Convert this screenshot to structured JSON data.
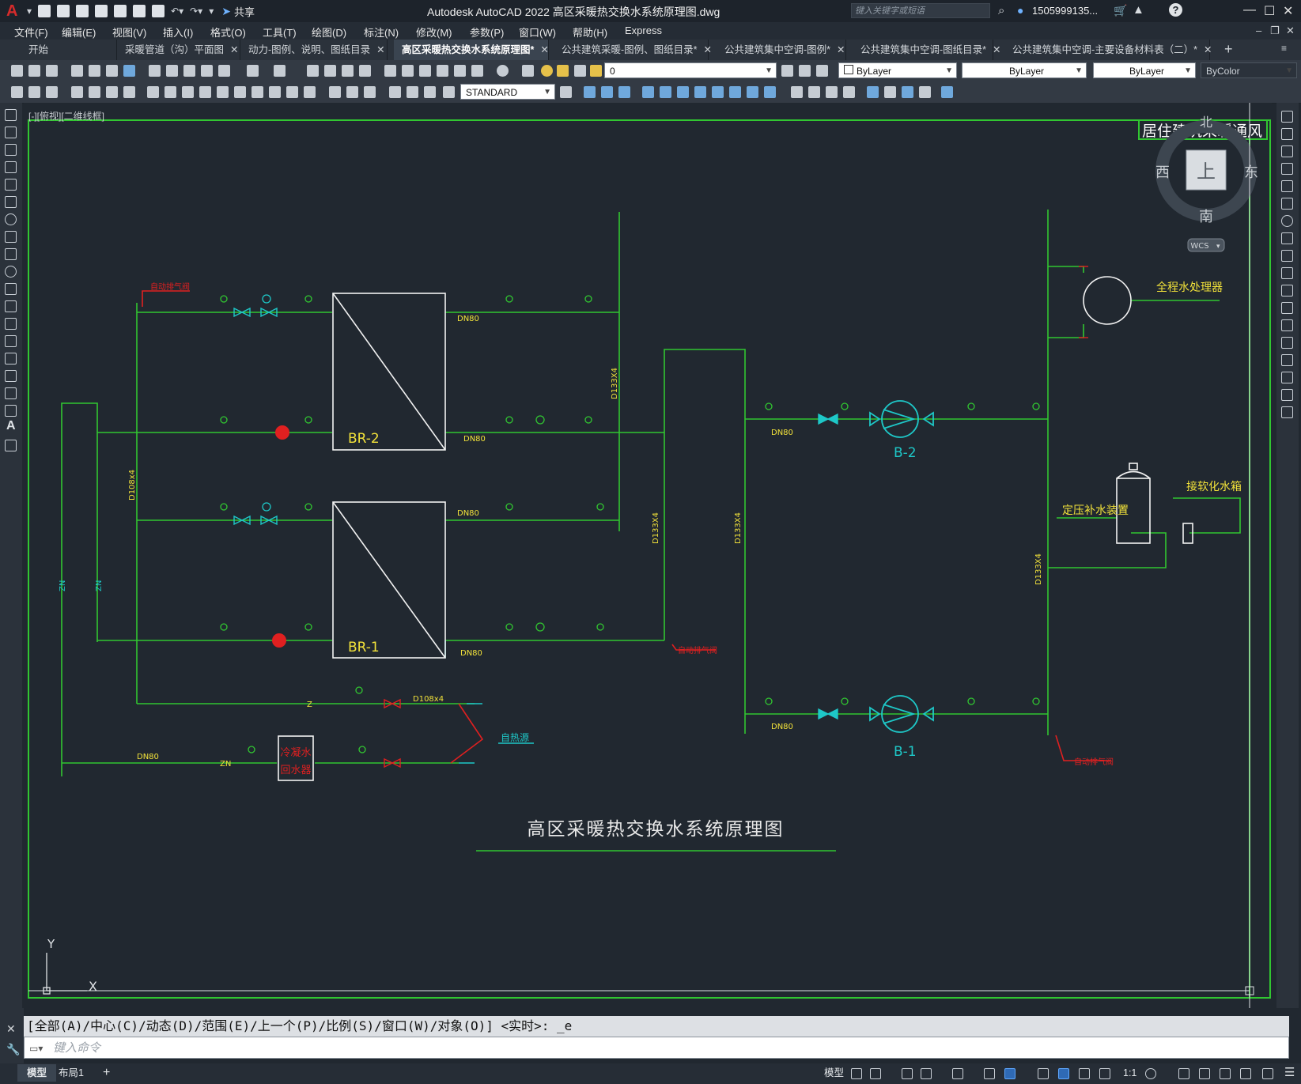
{
  "app": {
    "logo": "A",
    "title": "Autodesk AutoCAD 2022    高区采暖热交换水系统原理图.dwg",
    "share_label": "共享",
    "search_placeholder": "键入关键字或短语",
    "user": "1505999135...",
    "help": "?"
  },
  "menu": [
    "文件(F)",
    "编辑(E)",
    "视图(V)",
    "插入(I)",
    "格式(O)",
    "工具(T)",
    "绘图(D)",
    "标注(N)",
    "修改(M)",
    "参数(P)",
    "窗口(W)",
    "帮助(H)",
    "Express"
  ],
  "tabs": [
    {
      "label": "开始",
      "active": false,
      "closable": false
    },
    {
      "label": "采暖管道（沟）平面图",
      "active": false,
      "closable": true
    },
    {
      "label": "动力-图例、说明、图纸目录",
      "active": false,
      "closable": true
    },
    {
      "label": "高区采暖热交换水系统原理图*",
      "active": true,
      "closable": true
    },
    {
      "label": "公共建筑采暖-图例、图纸目录*",
      "active": false,
      "closable": true
    },
    {
      "label": "公共建筑集中空调-图例*",
      "active": false,
      "closable": true
    },
    {
      "label": "公共建筑集中空调-图纸目录*",
      "active": false,
      "closable": true
    },
    {
      "label": "公共建筑集中空调-主要设备材料表（二）*",
      "active": false,
      "closable": true
    }
  ],
  "toolbar": {
    "layer_value": "0",
    "color_value": "ByLayer",
    "linetype_value": "ByLayer",
    "lineweight_value": "ByLayer",
    "plotstyle_value": "ByColor",
    "textstyle_value": "STANDARD"
  },
  "viewport_label": "[-][俯视][二维线框]",
  "viewcube": {
    "top_face": "上",
    "north": "北",
    "south": "南",
    "east": "东",
    "west": "西",
    "ucs": "WCS"
  },
  "ucs_icon": {
    "x": "X",
    "y": "Y"
  },
  "drawing": {
    "title": "高区采暖热交换水系统原理图",
    "frame_label": "居住建筑采暖通风",
    "equipment": {
      "br2": "BR-2",
      "br1": "BR-1",
      "b2": "B-2",
      "b1": "B-1",
      "water_treater": "全程水处理器",
      "softened_tank": "接软化水箱",
      "pressure_device": "定压补水装置",
      "cold_return_1": "冷凝水",
      "cold_return_2": "回水器",
      "heat_source": "自热源"
    },
    "annotations": {
      "auto_vent": "自动排气阀",
      "dn80": "DN80",
      "d108": "D108x4",
      "d133": "D133X4",
      "zn": "ZN",
      "z": "Z"
    }
  },
  "command": {
    "history": "[全部(A)/中心(C)/动态(D)/范围(E)/上一个(P)/比例(S)/窗口(W)/对象(O)] <实时>: _e",
    "placeholder": "键入命令"
  },
  "status": {
    "tabs": [
      "模型",
      "布局1"
    ],
    "model_label": "模型",
    "scale": "1:1"
  },
  "colors": {
    "pipe": "#31c631",
    "equipment": "#f2f2f2",
    "label_yellow": "#f2e23a",
    "accent_red": "#e02020",
    "cyan": "#1ec8c8"
  }
}
